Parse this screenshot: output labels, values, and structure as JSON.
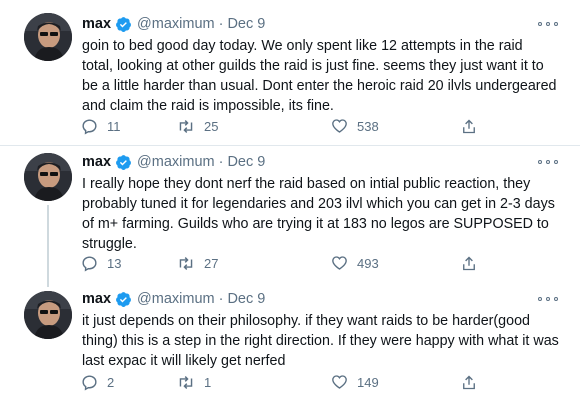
{
  "colors": {
    "verified": "#1d9bf0",
    "secondary_text": "#5b7083",
    "thread_line": "#cfd9de"
  },
  "tweets": [
    {
      "name": "max",
      "handle": "@maximum",
      "separator": "·",
      "date": "Dec 9",
      "lines": [
        "goin to bed good day today.  We only spent like 12 attempts in the raid",
        "total, looking at other guilds the raid is just fine.  seems they just want it to",
        "be a little harder than usual.  Dont enter the heroic raid 20 ilvls undergeared",
        "and claim the raid is impossible, its fine."
      ],
      "replies": "11",
      "retweets": "25",
      "likes": "538"
    },
    {
      "name": "max",
      "handle": "@maximum",
      "separator": "·",
      "date": "Dec 9",
      "lines": [
        "I really hope they dont nerf the raid based on intial public reaction, they",
        "probably tuned it for legendaries and 203 ilvl which you can get in 2-3 days",
        "of m+ farming.  Guilds who are trying it at 183 no legos are SUPPOSED to",
        "struggle."
      ],
      "replies": "13",
      "retweets": "27",
      "likes": "493"
    },
    {
      "name": "max",
      "handle": "@maximum",
      "separator": "·",
      "date": "Dec 9",
      "lines": [
        "it just depends on their philosophy.  if they want raids to be harder(good",
        "thing) this is a step in the right direction.  If they were happy with what it was",
        "last expac it will likely get nerfed"
      ],
      "replies": "2",
      "retweets": "1",
      "likes": "149"
    }
  ]
}
